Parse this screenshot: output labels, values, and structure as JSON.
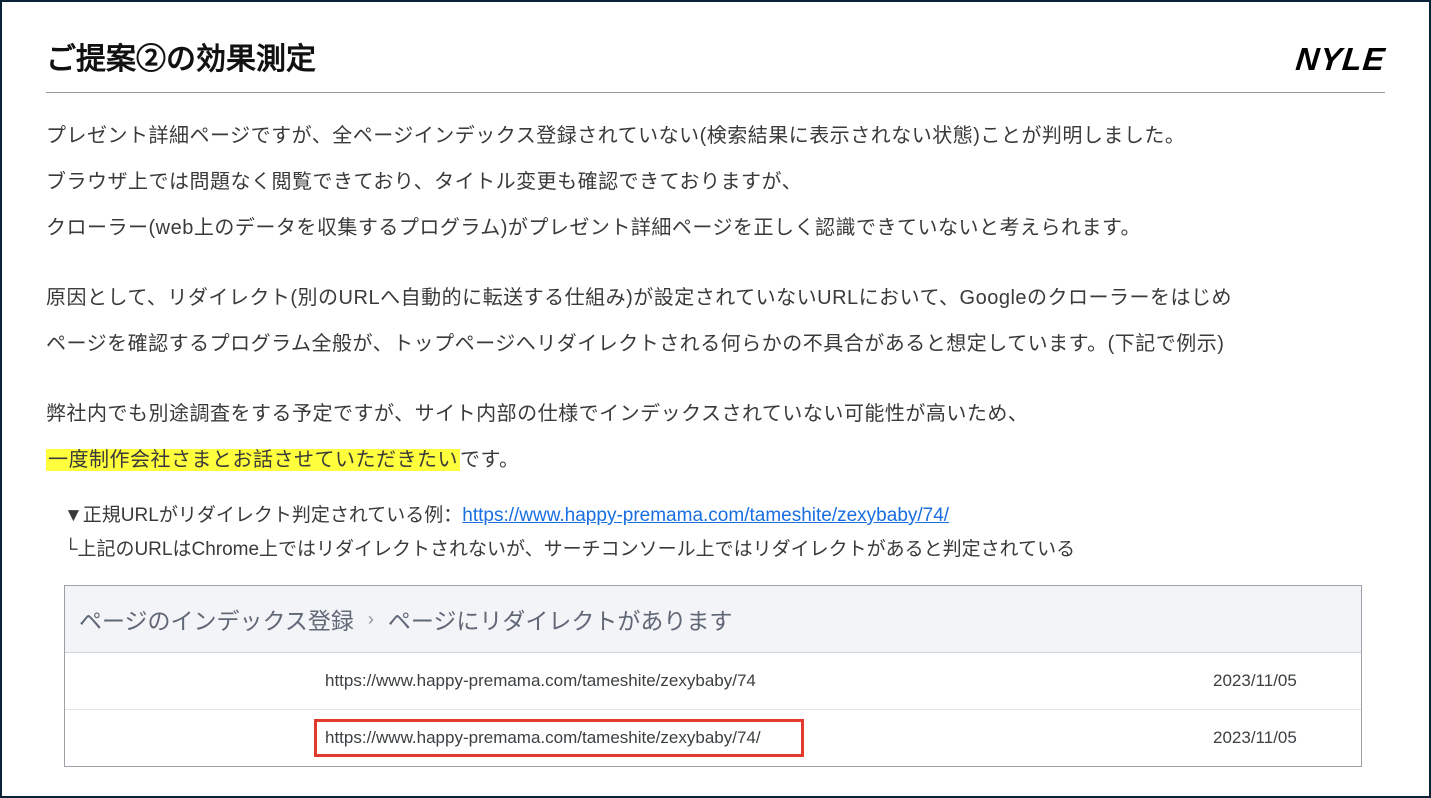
{
  "header": {
    "title": "ご提案②の効果測定",
    "logo": "NYLE"
  },
  "body": {
    "p1": "プレゼント詳細ページですが、全ページインデックス登録されていない(検索結果に表示されない状態)ことが判明しました。",
    "p2": "ブラウザ上では問題なく閲覧できており、タイトル変更も確認できておりますが、",
    "p3": "クローラー(web上のデータを収集するプログラム)がプレゼント詳細ページを正しく認識できていないと考えられます。",
    "p4": "原因として、リダイレクト(別のURLへ自動的に転送する仕組み)が設定されていないURLにおいて、Googleのクローラーをはじめ",
    "p5": "ページを確認するプログラム全般が、トップページへリダイレクトされる何らかの不具合があると想定しています。(下記で例示)",
    "p6a": "弊社内でも別途調査をする予定ですが、サイト内部の仕様でインデックスされていない可能性が高いため、",
    "p7_highlight": "一度制作会社さまとお話させていただきたい",
    "p7_after": "です。"
  },
  "example": {
    "line1_prefix": "▼正規URLがリダイレクト判定されている例：",
    "line1_link": "https://www.happy-premama.com/tameshite/zexybaby/74/",
    "line2": "└上記のURLはChrome上ではリダイレクトされないが、サーチコンソール上ではリダイレクトがあると判定されている"
  },
  "sc": {
    "breadcrumb_a": "ページのインデックス登録",
    "breadcrumb_sep": "›",
    "breadcrumb_b": "ページにリダイレクトがあります",
    "rows": [
      {
        "url": "https://www.happy-premama.com/tameshite/zexybaby/74",
        "date": "2023/11/05"
      },
      {
        "url": "https://www.happy-premama.com/tameshite/zexybaby/74/",
        "date": "2023/11/05"
      }
    ]
  }
}
